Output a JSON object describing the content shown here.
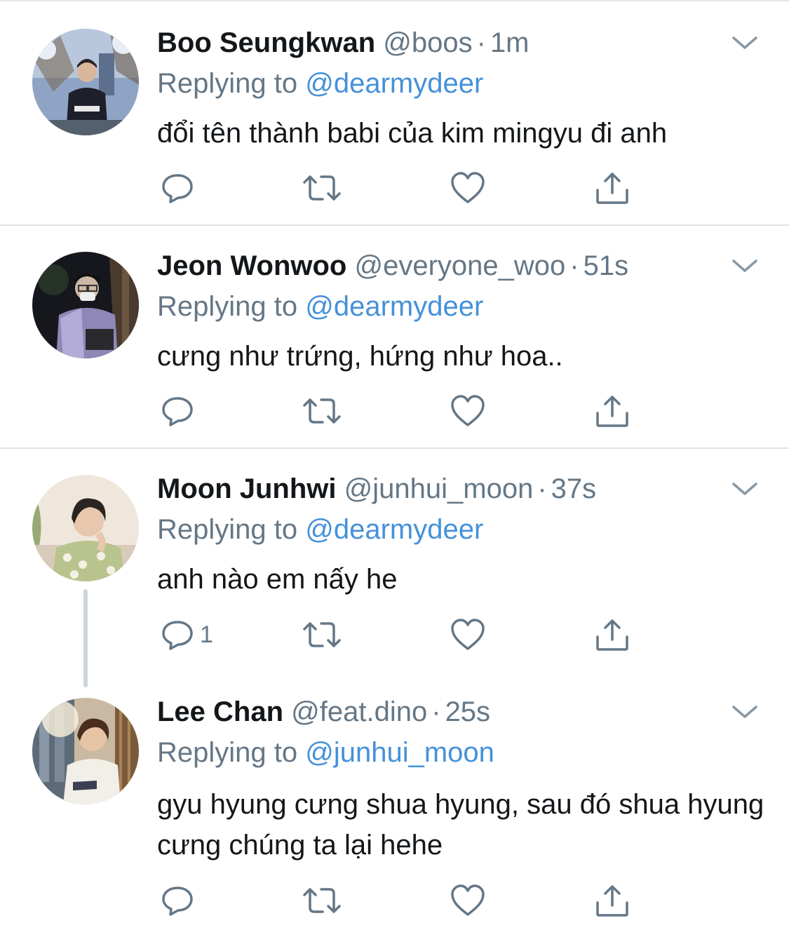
{
  "tweets": [
    {
      "name": "Boo Seungkwan",
      "handle": "@boos",
      "separator": "·",
      "time": "1m",
      "replying_prefix": "Replying to",
      "replying_to": "@dearmydeer",
      "text": "đổi tên thành babi của kim mingyu đi anh",
      "reply_count": ""
    },
    {
      "name": "Jeon Wonwoo",
      "handle": "@everyone_woo",
      "separator": "·",
      "time": "51s",
      "replying_prefix": "Replying to",
      "replying_to": "@dearmydeer",
      "text": "cưng như trứng, hứng như hoa..",
      "reply_count": ""
    },
    {
      "name": "Moon Junhwi",
      "handle": "@junhui_moon",
      "separator": "·",
      "time": "37s",
      "replying_prefix": "Replying to",
      "replying_to": "@dearmydeer",
      "text": "anh nào em nấy he",
      "reply_count": "1"
    },
    {
      "name": "Lee Chan",
      "handle": "@feat.dino",
      "separator": "·",
      "time": "25s",
      "replying_prefix": "Replying to",
      "replying_to": "@junhui_moon",
      "text": "gyu hyung cưng shua hyung, sau đó shua hyung cưng chúng ta lại hehe",
      "reply_count": ""
    }
  ],
  "icons": {
    "reply": "reply-icon",
    "retweet": "retweet-icon",
    "like": "heart-icon",
    "share": "share-icon",
    "more": "chevron-down-icon"
  },
  "colors": {
    "mention": "#4591d9",
    "secondary_text": "#657786",
    "icon": "#657786",
    "divider": "#dfe3e6"
  }
}
